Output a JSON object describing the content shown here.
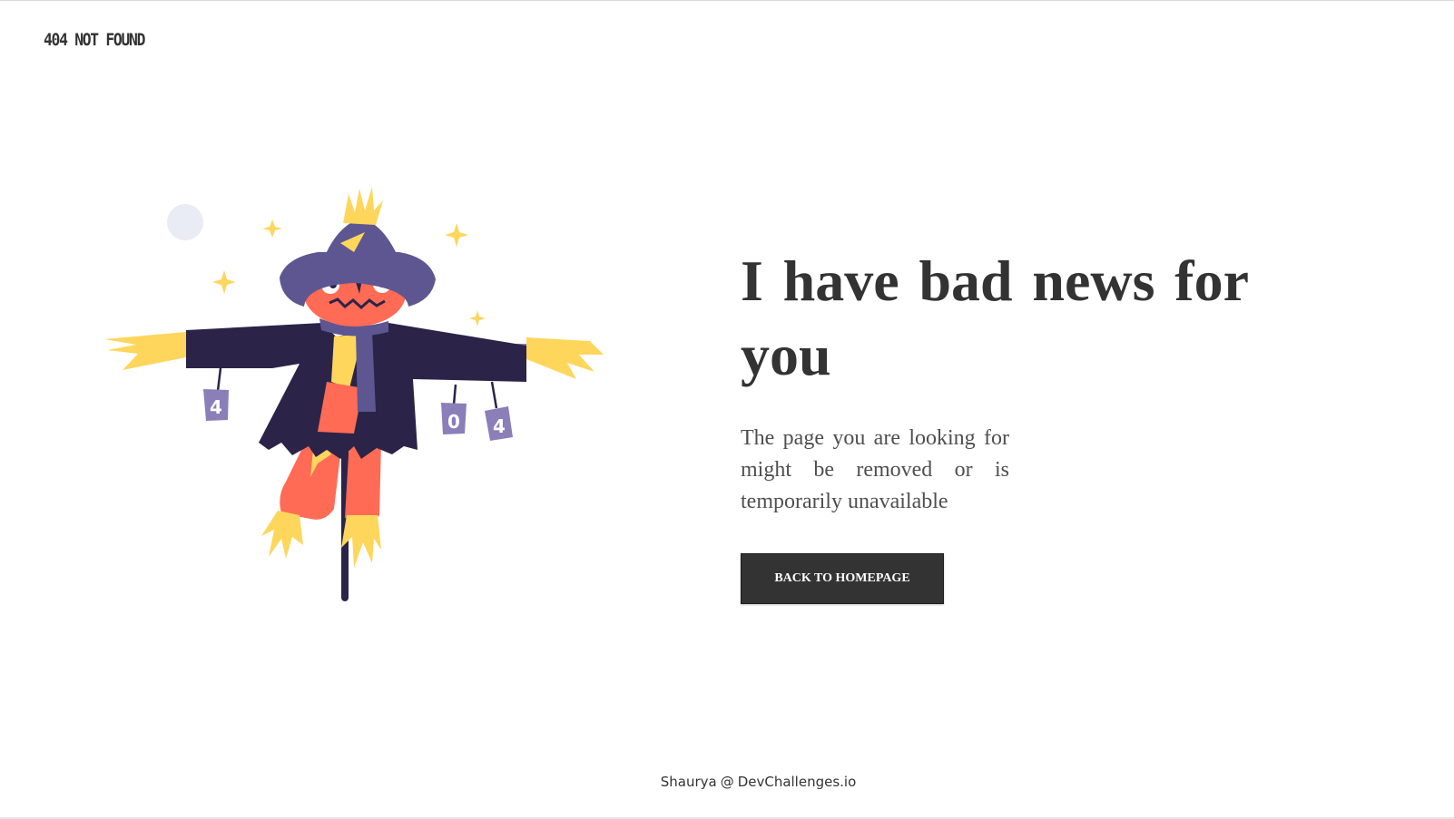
{
  "header": {
    "brand": "404 NOT FOUND"
  },
  "main": {
    "headline": "I have bad news for you",
    "message": "The page you are looking for might be removed or is temporarily unavailable",
    "cta_label": "BACK TO HOMEPAGE"
  },
  "illustration": {
    "subject": "scarecrow",
    "cans": [
      "4",
      "0",
      "4"
    ]
  },
  "footer": {
    "author": "Shaurya",
    "separator": "@",
    "site": "DevChallenges.io"
  },
  "colors": {
    "text_dark": "#333333",
    "text_body": "#4f4f4f",
    "button_bg": "#333333",
    "button_text": "#ffffff",
    "background": "#ffffff",
    "scarecrow_coat": "#2b2448",
    "scarecrow_hat": "#5e5691",
    "scarecrow_head": "#ff6b55",
    "straw": "#ffd65c",
    "can": "#8a7fb8"
  }
}
